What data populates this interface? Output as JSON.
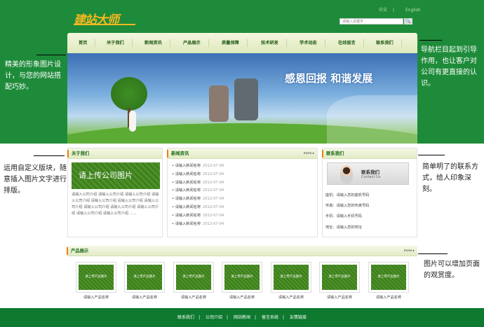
{
  "header": {
    "logo_text": "建站大师",
    "lang_cn": "中文",
    "lang_sep": "|",
    "lang_en": "English",
    "search_placeholder": "请输入关键字",
    "search_button": "🔍"
  },
  "nav": {
    "items": [
      "首页",
      "关于我们",
      "新闻资讯",
      "产品展示",
      "质量保障",
      "技术研发",
      "学术动态",
      "在线留言",
      "联系我们"
    ]
  },
  "banner": {
    "slogan": "感恩回报 和谐发展"
  },
  "about": {
    "title": "关于我们",
    "image_text": "请上传公司图片",
    "text": "请输入公司介绍 请输入公司介绍 请输入公司介绍 请输入公司介绍 请输入公司介绍 请输入公司介绍 请输入公司介绍 请输入公司介绍 请输入公司介绍 请输入公司介绍 请输入公司介绍 请输入公司介绍 ......"
  },
  "news": {
    "title": "新闻资讯",
    "more": "more",
    "items": [
      {
        "title": "请输入新闻名称",
        "date": "2012-07-04"
      },
      {
        "title": "请输入新闻名称",
        "date": "2012-07-04"
      },
      {
        "title": "请输入新闻名称",
        "date": "2012-07-04"
      },
      {
        "title": "请输入新闻名称",
        "date": "2012-07-04"
      },
      {
        "title": "请输入新闻名称",
        "date": "2012-07-04"
      },
      {
        "title": "请输入新闻名称",
        "date": "2012-07-04"
      },
      {
        "title": "请输入新闻名称",
        "date": "2012-07-04"
      },
      {
        "title": "请输入新闻名称",
        "date": "2012-07-04"
      }
    ]
  },
  "contact": {
    "title": "联系我们",
    "banner_cn": "联系我们",
    "banner_en": "Contact Us",
    "rows": [
      "座机：请输入您的座机号码",
      "传真：请输入您的传真号码",
      "手机：请输入手机号码",
      "地址：请输入您的地址"
    ]
  },
  "products": {
    "title": "产品展示",
    "more": "more",
    "image_text": "请上传产品图片",
    "items": [
      "请输入产品名称",
      "请输入产品名称",
      "请输入产品名称",
      "请输入产品名称",
      "请输入产品名称",
      "请输入产品名称",
      "请输入产品名称"
    ]
  },
  "footer": {
    "links": [
      "联系我们",
      "公司介绍",
      "网站新闻",
      "留言系统",
      "友情链接"
    ],
    "separator": "|"
  },
  "annotations": {
    "left_top": "精美的形象图片设计，与您的网站搭配巧妙。",
    "right_top": "导航栏目起到引导作用，也让客户对公司有更直接的认识。",
    "left_mid": "运用自定义版块，随意插入图片文字进行排版。",
    "right_mid": "简单明了的联系方式，给人印象深刻。",
    "right_bottom": "图片可以增加页面的观赏度。"
  }
}
